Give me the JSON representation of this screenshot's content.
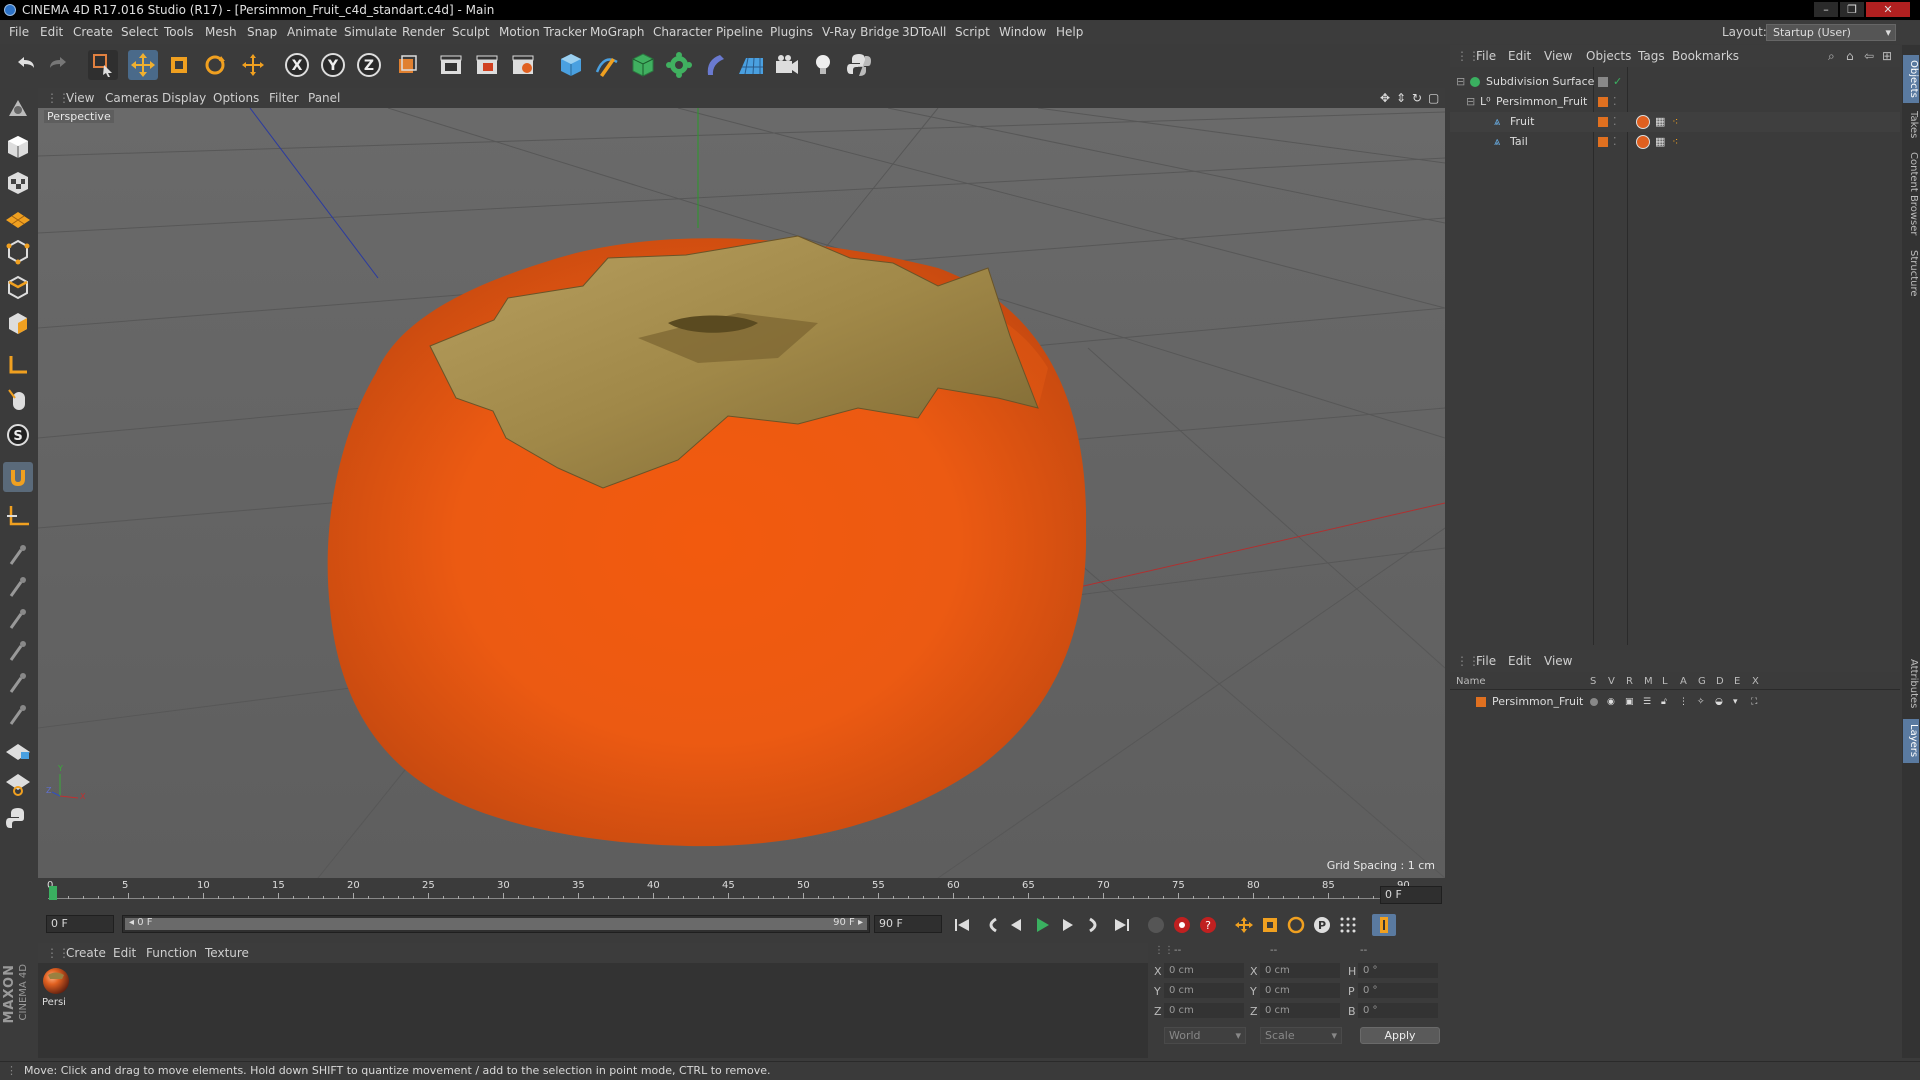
{
  "window": {
    "title": "CINEMA 4D R17.016 Studio (R17) - [Persimmon_Fruit_c4d_standart.c4d] - Main",
    "controls": [
      "–",
      "❐",
      "✕"
    ]
  },
  "menubar": {
    "items": [
      "File",
      "Edit",
      "Create",
      "Select",
      "Tools",
      "Mesh",
      "Snap",
      "Animate",
      "Simulate",
      "Render",
      "Sculpt",
      "Motion Tracker",
      "MoGraph",
      "Character",
      "Pipeline",
      "Plugins",
      "V-Ray Bridge",
      "3DToAll",
      "Script",
      "Window",
      "Help"
    ],
    "layout_label": "Layout:",
    "layout_value": "Startup (User)"
  },
  "viewport": {
    "menu": [
      "View",
      "Cameras",
      "Display",
      "Options",
      "Filter",
      "Panel"
    ],
    "label": "Perspective",
    "grid_spacing": "Grid Spacing : 1 cm",
    "axis_labels": {
      "y": "Y",
      "x": "X",
      "z": "Z"
    }
  },
  "timeline": {
    "ticks": [
      "0",
      "5",
      "10",
      "15",
      "20",
      "25",
      "30",
      "35",
      "40",
      "45",
      "50",
      "55",
      "60",
      "65",
      "70",
      "75",
      "80",
      "85",
      "90"
    ],
    "current_frame_field": "0 F",
    "start_field": "0 F",
    "range_start": "◂ 0 F",
    "range_end": "90 F ▸",
    "end_field": "90 F"
  },
  "material_panel": {
    "menu": [
      "Create",
      "Edit",
      "Function",
      "Texture"
    ],
    "materials": [
      {
        "label": "Persi"
      }
    ]
  },
  "coordinates": {
    "headers": [
      "--",
      "--",
      "--"
    ],
    "rows": [
      {
        "a_label": "X",
        "a_val": "0 cm",
        "b_label": "X",
        "b_val": "0 cm",
        "c_label": "H",
        "c_val": "0 °"
      },
      {
        "a_label": "Y",
        "a_val": "0 cm",
        "b_label": "Y",
        "b_val": "0 cm",
        "c_label": "P",
        "c_val": "0 °"
      },
      {
        "a_label": "Z",
        "a_val": "0 cm",
        "b_label": "Z",
        "b_val": "0 cm",
        "c_label": "B",
        "c_val": "0 °"
      }
    ],
    "mode_world": "World",
    "mode_scale": "Scale",
    "apply": "Apply"
  },
  "object_manager": {
    "menu": [
      "File",
      "Edit",
      "View",
      "Objects",
      "Tags",
      "Bookmarks"
    ],
    "objects": [
      {
        "name": "Subdivision Surface",
        "indent": 0
      },
      {
        "name": "Persimmon_Fruit",
        "indent": 1
      },
      {
        "name": "Fruit",
        "indent": 2
      },
      {
        "name": "Tail",
        "indent": 2
      }
    ]
  },
  "layer_manager": {
    "menu": [
      "File",
      "Edit",
      "View"
    ],
    "columns": [
      "Name",
      "S",
      "V",
      "R",
      "M",
      "L",
      "A",
      "G",
      "D",
      "E",
      "X"
    ],
    "layers": [
      {
        "name": "Persimmon_Fruit"
      }
    ]
  },
  "right_tabs": [
    "Objects",
    "Takes",
    "Content Browser",
    "Structure",
    "Attributes",
    "Layers"
  ],
  "brand": {
    "line1": "MAXON",
    "line2": "CINEMA 4D"
  },
  "status": "Move: Click and drag to move elements. Hold down SHIFT to quantize movement / add to the selection in point mode, CTRL to remove.",
  "colors": {
    "fruit": "#f05a10",
    "calyx": "#a48a4a",
    "accent": "#4a9fe0",
    "layer": "#e07020"
  }
}
